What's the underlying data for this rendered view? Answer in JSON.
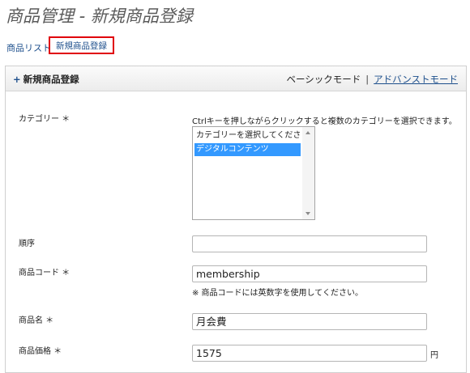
{
  "page": {
    "title": "商品管理 - 新規商品登録"
  },
  "subnav": {
    "product_list": "商品リスト",
    "new_product": "新規商品登録"
  },
  "panel": {
    "title": "新規商品登録",
    "plus": "+",
    "mode_basic": "ベーシックモード",
    "mode_separator": "|",
    "mode_advanced": "アドバンストモード"
  },
  "form": {
    "category": {
      "label": "カテゴリー ＊",
      "hint": "Ctrlキーを押しながらクリックすると複数のカテゴリーを選択できます。",
      "options": [
        "カテゴリーを選択してください",
        "デジタルコンテンツ"
      ],
      "selected_index": 1
    },
    "order": {
      "label": "順序",
      "value": ""
    },
    "product_code": {
      "label": "商品コード ＊",
      "value": "membership",
      "hint": "※ 商品コードには英数字を使用してください。"
    },
    "product_name": {
      "label": "商品名 ＊",
      "value": "月会費"
    },
    "price": {
      "label": "商品価格 ＊",
      "value": "1575",
      "unit": "円"
    }
  }
}
